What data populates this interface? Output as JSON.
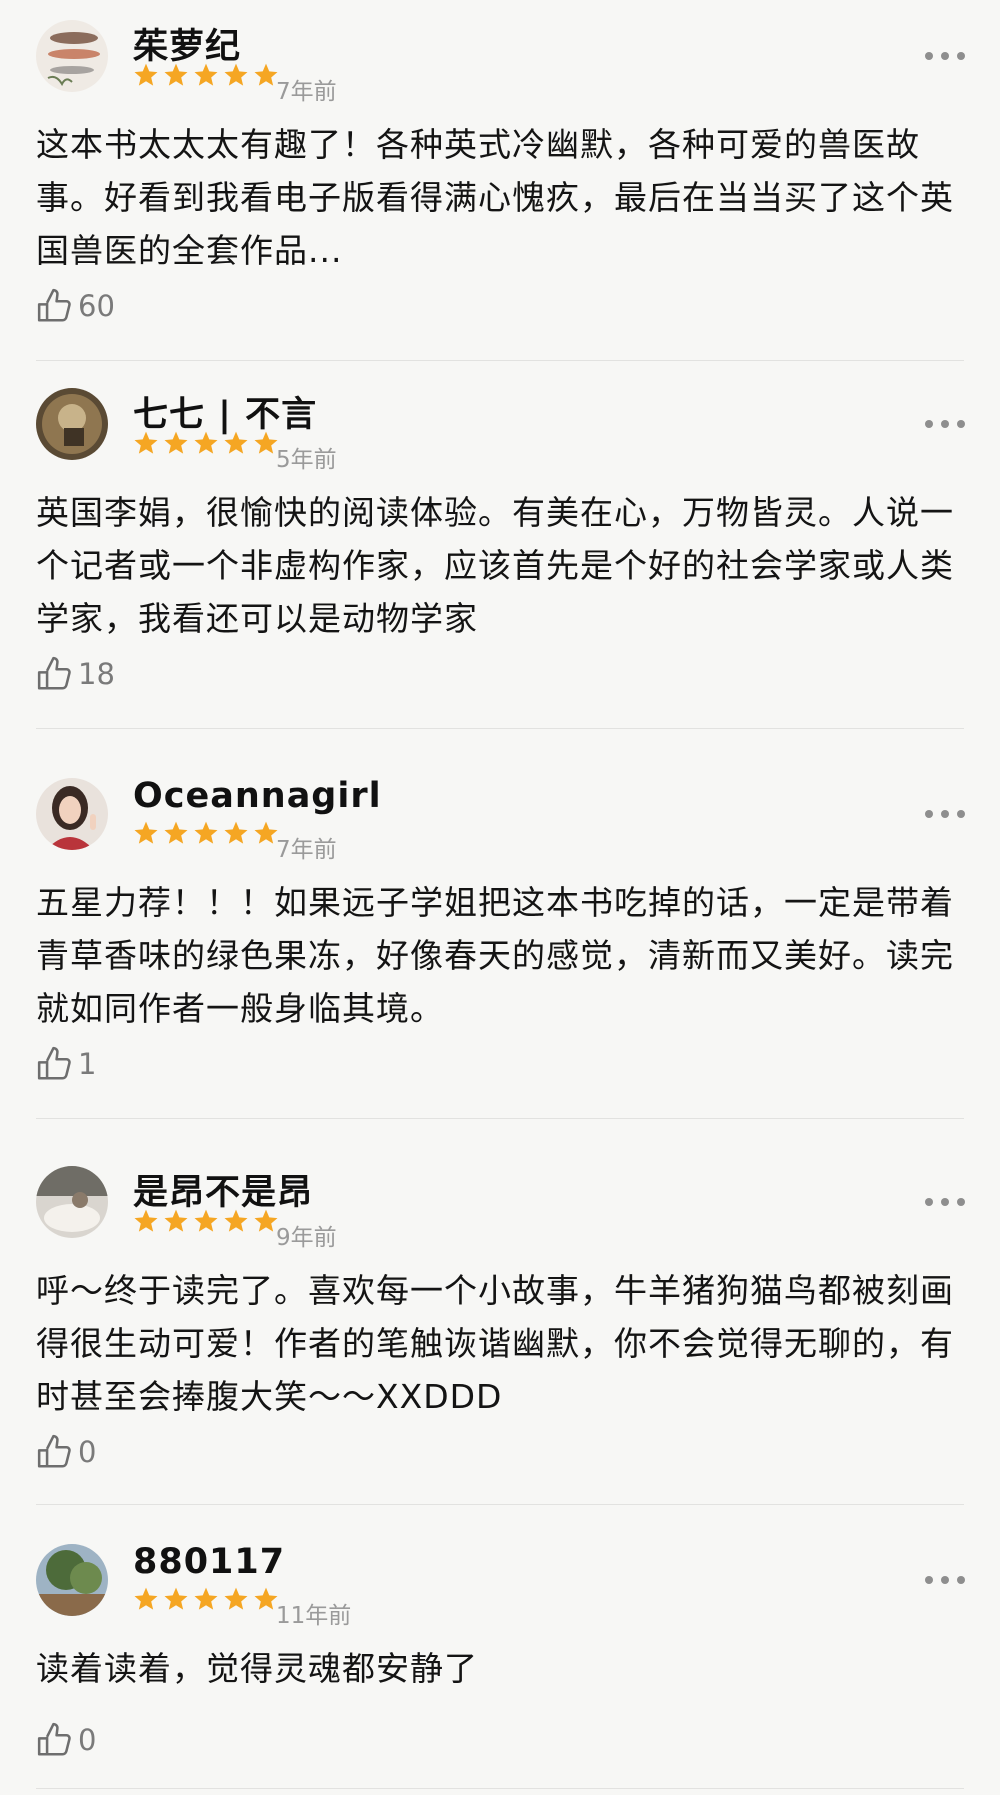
{
  "colors": {
    "star": "#f5a623",
    "muted": "#9a9a9a",
    "text": "#141414",
    "background": "#f7f7f5"
  },
  "icons": {
    "rating": "star-icon",
    "like": "thumbs-up-icon",
    "more": "more-horizontal-icon"
  },
  "reviews": [
    {
      "username": "茱萝纪",
      "rating": 5,
      "time": "7年前",
      "content": "这本书太太太有趣了！各种英式冷幽默，各种可爱的兽医故事。好看到我看电子版看得满心愧疚，最后在当当买了这个英国兽医的全套作品...",
      "likes": "60"
    },
    {
      "username": "七七 | 不言",
      "rating": 5,
      "time": "5年前",
      "content": "英国李娟，很愉快的阅读体验。有美在心，万物皆灵。人说一个记者或一个非虚构作家，应该首先是个好的社会学家或人类学家，我看还可以是动物学家",
      "likes": "18"
    },
    {
      "username": "Oceannagirl",
      "rating": 5,
      "time": "7年前",
      "content": "五星力荐！！！如果远子学姐把这本书吃掉的话，一定是带着青草香味的绿色果冻，好像春天的感觉，清新而又美好。读完就如同作者一般身临其境。",
      "likes": "1"
    },
    {
      "username": "是昂不是昂",
      "rating": 5,
      "time": "9年前",
      "content": "呼～终于读完了。喜欢每一个小故事，牛羊猪狗猫鸟都被刻画得很生动可爱！作者的笔触诙谐幽默，你不会觉得无聊的，有时甚至会捧腹大笑～～XXDDD",
      "likes": "0"
    },
    {
      "username": "880117",
      "rating": 5,
      "time": "11年前",
      "content": "读着读着，觉得灵魂都安静了",
      "likes": "0"
    }
  ]
}
